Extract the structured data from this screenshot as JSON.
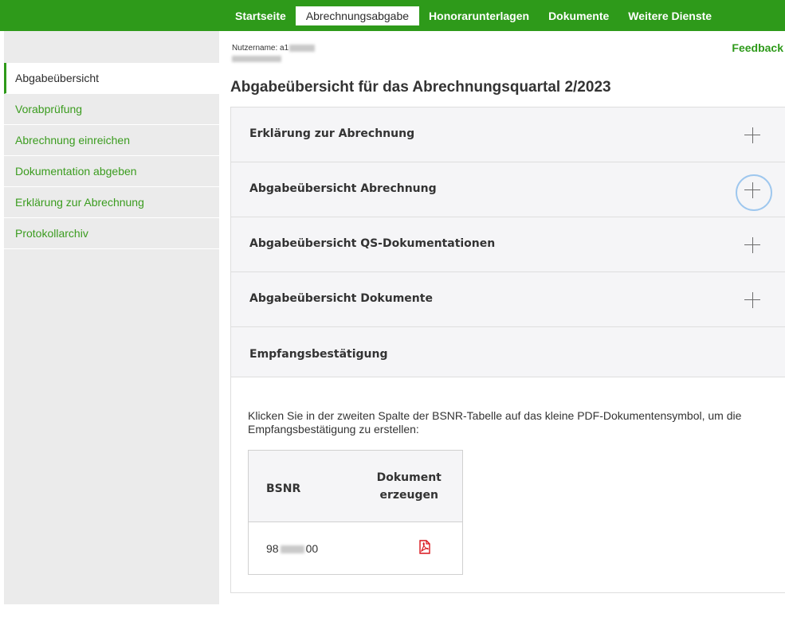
{
  "topnav": {
    "items": [
      {
        "label": "Startseite"
      },
      {
        "label": "Abrechnungsabgabe"
      },
      {
        "label": "Honorarunterlagen"
      },
      {
        "label": "Dokumente"
      },
      {
        "label": "Weitere Dienste"
      }
    ],
    "active_index": 1
  },
  "sidebar": {
    "items": [
      {
        "label": "Abgabeübersicht"
      },
      {
        "label": "Vorabprüfung"
      },
      {
        "label": "Abrechnung einreichen"
      },
      {
        "label": "Dokumentation abgeben"
      },
      {
        "label": "Erklärung zur Abrechnung"
      },
      {
        "label": "Protokollarchiv"
      }
    ],
    "active_index": 0
  },
  "header": {
    "username_label": "Nutzername: a1",
    "feedback_label": "Feedback"
  },
  "page": {
    "title": "Abgabeübersicht für das Abrechnungsquartal 2/2023"
  },
  "accordion": {
    "panels": [
      {
        "title": "Erklärung zur Abrechnung",
        "icon": "plus-icon"
      },
      {
        "title": "Abgabeübersicht Abrechnung",
        "icon": "plus-icon",
        "focused": true
      },
      {
        "title": "Abgabeübersicht QS-Dokumentationen",
        "icon": "plus-icon"
      },
      {
        "title": "Abgabeübersicht Dokumente",
        "icon": "plus-icon"
      }
    ],
    "open_panel": {
      "title": "Empfangsbestätigung",
      "description": "Klicken Sie in der zweiten Spalte der BSNR-Tabelle auf das kleine PDF-Dokumentensymbol, um die Empfangsbestätigung zu erstellen:",
      "table": {
        "headers": [
          "BSNR",
          "Dokument erzeugen"
        ],
        "rows": [
          {
            "bsnr_prefix": "98",
            "bsnr_suffix": "00",
            "icon": "pdf-icon"
          }
        ]
      }
    }
  },
  "colors": {
    "brand_green": "#2e9a1a",
    "link_green": "#3b9c1f",
    "focus_ring": "#9ec7ee",
    "pdf_red": "#d8141b"
  }
}
